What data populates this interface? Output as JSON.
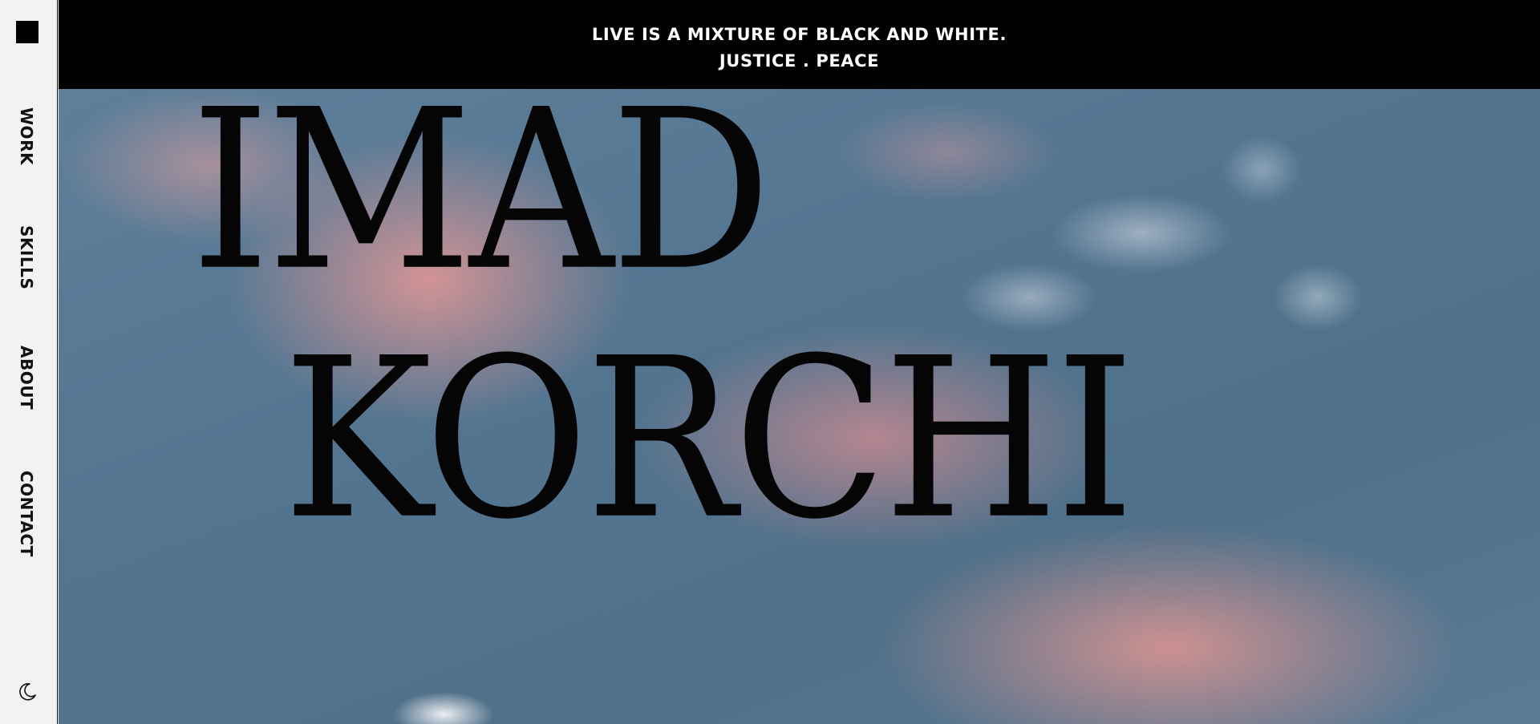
{
  "sidebar": {
    "logo": "square-logo",
    "nav": [
      {
        "label": "WORK"
      },
      {
        "label": "SKILLS"
      },
      {
        "label": "ABOUT"
      },
      {
        "label": "CONTACT"
      }
    ],
    "theme_toggle_icon": "moon-icon"
  },
  "banner": {
    "line1": "LIVE IS A MIXTURE OF BLACK AND WHITE.",
    "line2": "JUSTICE . PEACE"
  },
  "hero": {
    "first_name": "IMAD",
    "last_name": "KORCHI",
    "background": "pink-clouds-sky-image"
  },
  "colors": {
    "sidebar_bg": "#f2f2f2",
    "banner_bg": "#000000",
    "banner_text": "#ffffff",
    "name_text": "#050505"
  }
}
